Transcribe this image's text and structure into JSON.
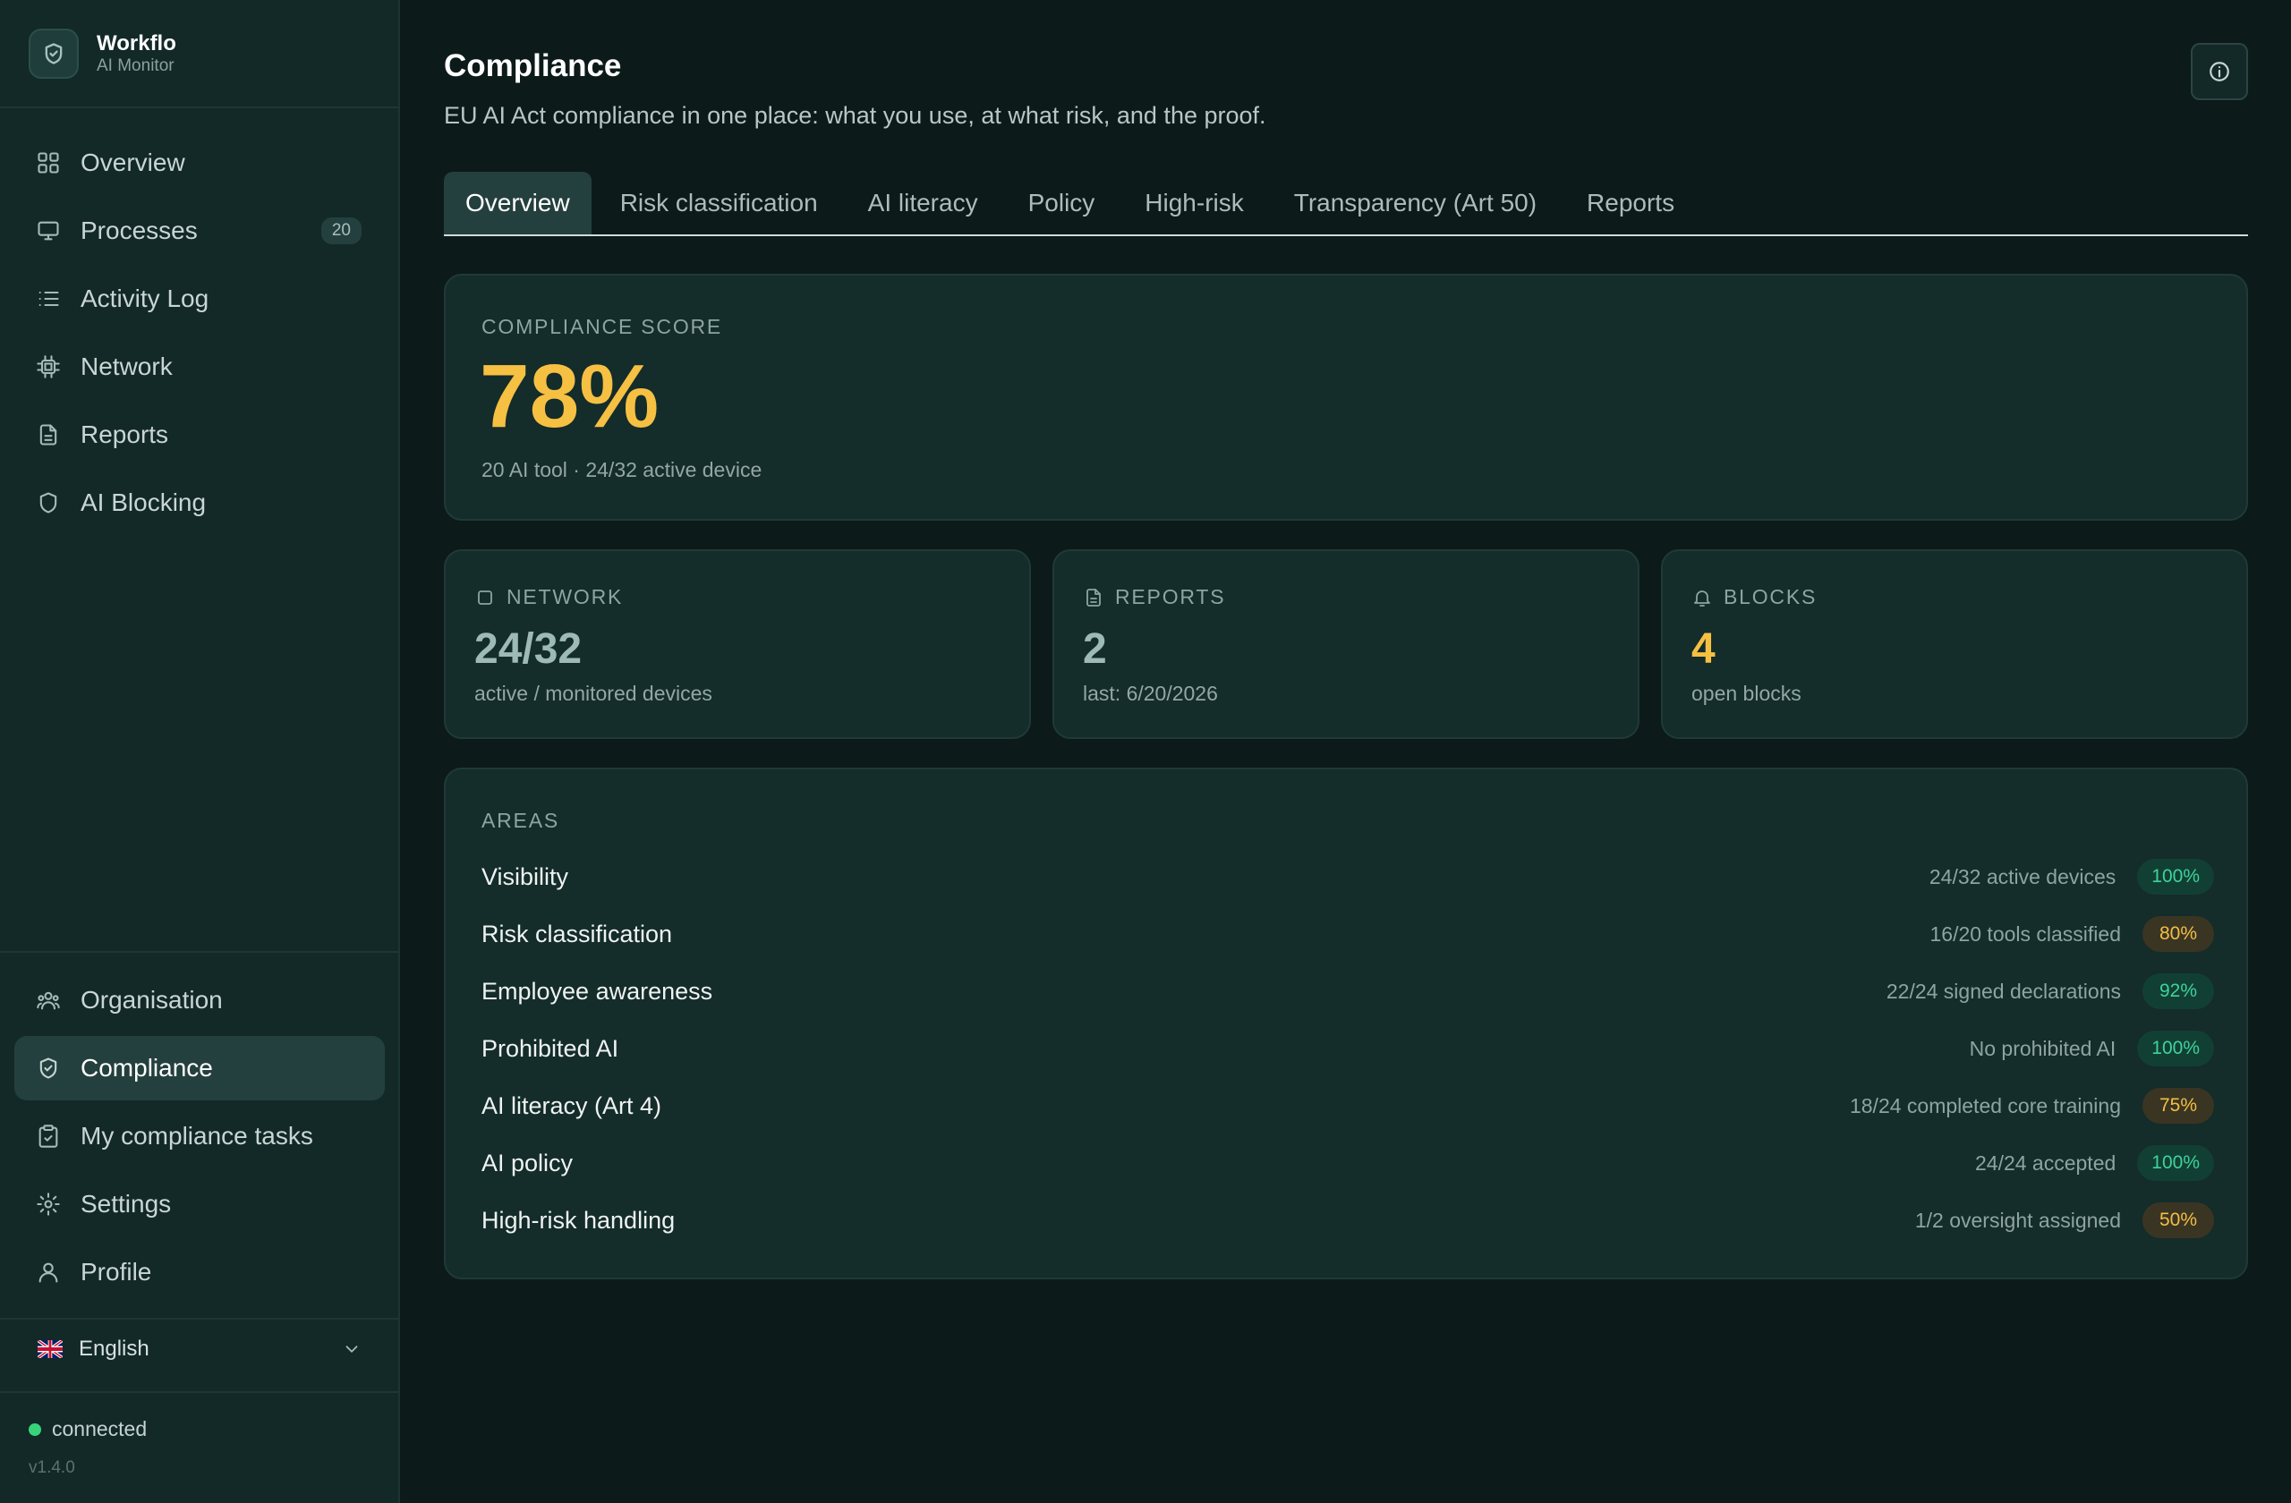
{
  "brand": {
    "name": "Workflo",
    "subtitle": "AI Monitor"
  },
  "sidebar": {
    "top_items": [
      {
        "label": "Overview",
        "icon": "grid-icon"
      },
      {
        "label": "Processes",
        "icon": "monitor-icon",
        "badge": "20"
      },
      {
        "label": "Activity Log",
        "icon": "list-icon"
      },
      {
        "label": "Network",
        "icon": "chip-icon"
      },
      {
        "label": "Reports",
        "icon": "file-text-icon"
      },
      {
        "label": "AI Blocking",
        "icon": "shield-icon"
      }
    ],
    "bottom_items": [
      {
        "label": "Organisation",
        "icon": "users-icon"
      },
      {
        "label": "Compliance",
        "icon": "shield-check-icon",
        "active": true
      },
      {
        "label": "My compliance tasks",
        "icon": "clipboard-icon"
      },
      {
        "label": "Settings",
        "icon": "gear-icon"
      },
      {
        "label": "Profile",
        "icon": "user-icon"
      }
    ],
    "language": {
      "label": "English",
      "flag": "uk-flag-icon"
    },
    "status": {
      "label": "connected",
      "color": "#37d47a"
    },
    "version": "v1.4.0"
  },
  "page": {
    "title": "Compliance",
    "subtitle": "EU AI Act compliance in one place: what you use, at what risk, and the proof."
  },
  "tabs": [
    {
      "label": "Overview",
      "active": true
    },
    {
      "label": "Risk classification"
    },
    {
      "label": "AI literacy"
    },
    {
      "label": "Policy"
    },
    {
      "label": "High-risk"
    },
    {
      "label": "Transparency (Art 50)"
    },
    {
      "label": "Reports"
    }
  ],
  "score": {
    "label": "Compliance score",
    "value": "78%",
    "note": "20 AI tool · 24/32 active device",
    "color": "#f6c042"
  },
  "stats": [
    {
      "label": "Network",
      "icon": "chip-icon",
      "value": "24/32",
      "note": "active / monitored devices",
      "color": "#9dbab5"
    },
    {
      "label": "Reports",
      "icon": "file-text-icon",
      "value": "2",
      "note": "last: 6/20/2026",
      "color": "#9dbab5"
    },
    {
      "label": "Blocks",
      "icon": "bell-icon",
      "value": "4",
      "note": "open blocks",
      "color": "#f6c042"
    }
  ],
  "areas": {
    "label": "Areas",
    "rows": [
      {
        "name": "Visibility",
        "detail": "24/32 active devices",
        "percent": "100%",
        "status": "good"
      },
      {
        "name": "Risk classification",
        "detail": "16/20 tools classified",
        "percent": "80%",
        "status": "warn"
      },
      {
        "name": "Employee awareness",
        "detail": "22/24 signed declarations",
        "percent": "92%",
        "status": "good"
      },
      {
        "name": "Prohibited AI",
        "detail": "No prohibited AI",
        "percent": "100%",
        "status": "good"
      },
      {
        "name": "AI literacy (Art 4)",
        "detail": "18/24 completed core training",
        "percent": "75%",
        "status": "warn"
      },
      {
        "name": "AI policy",
        "detail": "24/24 accepted",
        "percent": "100%",
        "status": "good"
      },
      {
        "name": "High-risk handling",
        "detail": "1/2 oversight assigned",
        "percent": "50%",
        "status": "warn"
      }
    ]
  },
  "colors": {
    "accent_good": "#3ed39a",
    "accent_warn": "#f3be45",
    "background": "#0c1a1a",
    "sidebar": "#122928"
  }
}
